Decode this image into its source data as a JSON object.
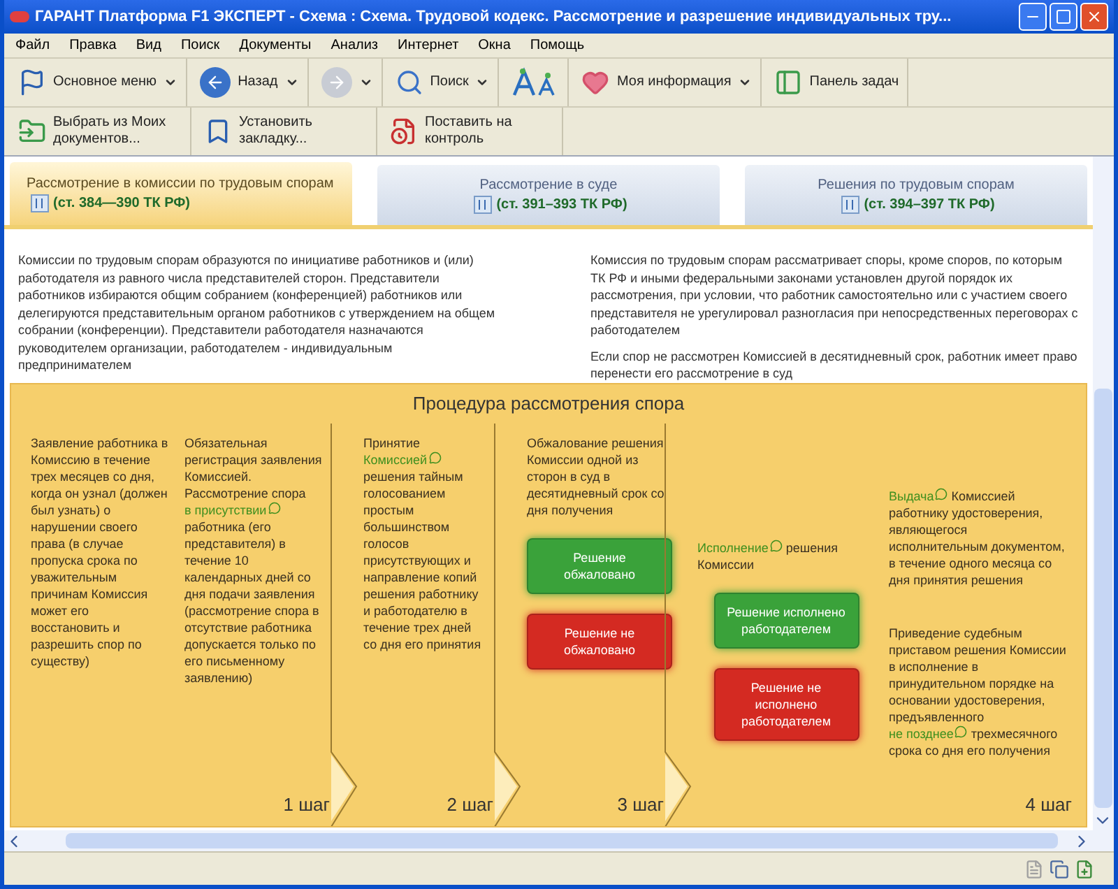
{
  "window": {
    "title": "ГАРАНТ Платформа F1 ЭКСПЕРТ - Схема : Схема. Трудовой кодекс. Рассмотрение и разрешение индивидуальных тру..."
  },
  "menu": [
    "Файл",
    "Правка",
    "Вид",
    "Поиск",
    "Документы",
    "Анализ",
    "Интернет",
    "Окна",
    "Помощь"
  ],
  "toolbar_rows": [
    [
      {
        "kind": "flag",
        "label": "Основное меню",
        "dropdown": true
      },
      {
        "kind": "back",
        "label": "Назад",
        "dropdown": true
      },
      {
        "kind": "forward",
        "dropdown": true,
        "disabled": true
      },
      {
        "kind": "search",
        "label": "Поиск",
        "dropdown": true
      },
      {
        "kind": "font",
        "dropdown": false
      },
      {
        "kind": "heart",
        "label": "Моя информация",
        "dropdown": true
      },
      {
        "kind": "panel",
        "label": "Панель задач",
        "dropdown": false
      }
    ],
    [
      {
        "kind": "folder",
        "label": "Выбрать из Моих документов...",
        "dropdown": false
      },
      {
        "kind": "bookmark",
        "label": "Установить закладку...",
        "dropdown": false
      },
      {
        "kind": "control",
        "label": "Поставить на контроль",
        "dropdown": false
      }
    ]
  ],
  "tabs": [
    {
      "label": "Рассмотрение в комиссии по трудовым спорам",
      "reference": "(ст. 384—390 ТК РФ)",
      "selected": true
    },
    {
      "label": "Рассмотрение в суде",
      "reference": "(ст. 391–393 ТК РФ)",
      "selected": false
    },
    {
      "label": "Решения по трудовым спорам",
      "reference": "(ст. 394–397 ТК РФ)",
      "selected": false
    }
  ],
  "intro_columns": [
    [
      "Комиссии по трудовым спорам образуются по инициативе работников и (или) работодателя из равного числа представителей сторон. Представители работников избираются общим собранием (конференцией) работников или делегируются представительным органом работников с утверждением на общем собрании (конференции). Представители работодателя назначаются руководителем организации, работодателем - индивидуальным предпринимателем"
    ],
    [
      "Комиссия по трудовым спорам рассматривает споры, кроме споров, по которым ТК РФ и иными федеральными законами установлен другой порядок их рассмотрения, при условии, что работник самостоятельно или с участием своего представителя не урегулировал разногласия при непосредственных переговорах с работодателем",
      "Если спор не рассмотрен Комиссией в десятидневный срок, работник имеет право перенести его рассмотрение в суд"
    ]
  ],
  "procedure": {
    "title": "Процедура рассмотрения спора",
    "steps": [
      {
        "label": "1 шаг",
        "columns": [
          {
            "blocks": [
              {
                "kind": "paragraph",
                "parts": [
                  {
                    "kind": "text",
                    "text": "Заявление работника в Комиссию в течение трех месяцев со дня, когда он узнал (должен был узнать) о нарушении своего права (в случае пропуска срока по уважительным причинам Комиссия может его восстановить и разрешить спор по существу)"
                  }
                ]
              }
            ]
          },
          {
            "blocks": [
              {
                "kind": "paragraph",
                "parts": [
                  {
                    "kind": "text",
                    "text": "Обязательная регистрация заявления Комиссией. Рассмотрение спора "
                  },
                  {
                    "kind": "link",
                    "text": "в присутствии"
                  },
                  {
                    "kind": "text",
                    "text": " работника (его представителя) в течение 10 календарных дней со дня подачи заявления (рассмотрение спора в отсутствие работника допускается только по его письменному заявлению)"
                  }
                ]
              }
            ]
          }
        ]
      },
      {
        "label": "2 шаг",
        "columns": [
          {
            "blocks": [
              {
                "kind": "paragraph",
                "parts": [
                  {
                    "kind": "text",
                    "text": "Принятие "
                  },
                  {
                    "kind": "link",
                    "text": "Комиссией"
                  },
                  {
                    "kind": "text",
                    "text": " решения тайным голосованием простым большинством голосов присутствующих и направление копий решения работнику и работодателю в течение трех дней со дня его принятия"
                  }
                ]
              }
            ]
          }
        ]
      },
      {
        "label": "3 шаг",
        "columns": [
          {
            "blocks": [
              {
                "kind": "paragraph",
                "parts": [
                  {
                    "kind": "text",
                    "text": "Обжалование решения Комиссии одной из сторон в суд в десятидневный срок со дня получения"
                  }
                ]
              },
              {
                "kind": "button",
                "text": "Решение обжаловано",
                "color": "#3aa23a"
              },
              {
                "kind": "button",
                "text": "Решение не обжаловано",
                "color": "#d42a22"
              }
            ]
          }
        ]
      },
      {
        "label": "4 шаг",
        "columns": [
          {
            "blocks": [
              {
                "kind": "paragraph",
                "parts": [
                  {
                    "kind": "link",
                    "text": "Исполнение"
                  },
                  {
                    "kind": "text",
                    "text": " решения Комиссии"
                  }
                ]
              },
              {
                "kind": "button",
                "text": "Решение исполнено работодателем",
                "color": "#3aa23a"
              },
              {
                "kind": "button",
                "text": "Решение не исполнено работодателем",
                "color": "#d42a22"
              }
            ]
          },
          {
            "blocks": [
              {
                "kind": "paragraph",
                "parts": [
                  {
                    "kind": "link",
                    "text": "Выдача"
                  },
                  {
                    "kind": "text",
                    "text": " Комиссией работнику удостоверения, являющегося исполнительным документом, в течение одного месяца со дня принятия решения"
                  }
                ]
              },
              {
                "kind": "paragraph",
                "parts": [
                  {
                    "kind": "text",
                    "text": "Приведение судебным приставом решения Комиссии в исполнение в принудительном порядке на основании удостоверения, предъявленного "
                  },
                  {
                    "kind": "link",
                    "text": "не позднее"
                  },
                  {
                    "kind": "text",
                    "text": " трехмесячного срока со дня его получения"
                  }
                ]
              }
            ]
          }
        ]
      }
    ]
  }
}
